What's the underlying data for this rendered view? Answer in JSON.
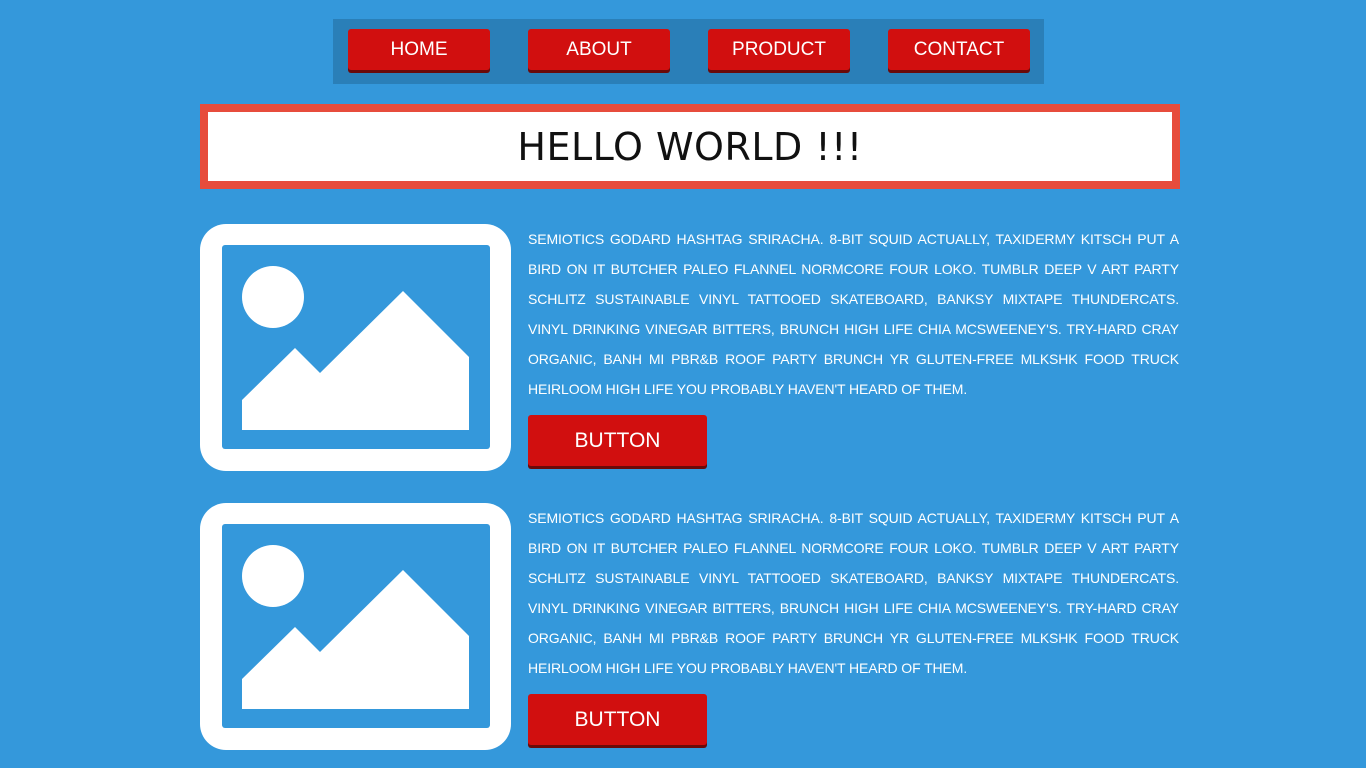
{
  "nav": {
    "items": [
      {
        "label": "HOME"
      },
      {
        "label": "ABOUT"
      },
      {
        "label": "PRODUCT"
      },
      {
        "label": "CONTACT"
      }
    ]
  },
  "hero": {
    "title": "HELLO WORLD !!!"
  },
  "cards": [
    {
      "text": "SEMIOTICS GODARD HASHTAG SRIRACHA. 8-BIT SQUID ACTUALLY, TAXIDERMY KITSCH PUT A BIRD ON IT BUTCHER PALEO FLANNEL NORMCORE FOUR LOKO. TUMBLR DEEP V ART PARTY SCHLITZ SUSTAINABLE VINYL TATTOOED SKATEBOARD, BANKSY MIXTAPE THUNDERCATS. VINYL DRINKING VINEGAR BITTERS, BRUNCH HIGH LIFE CHIA MCSWEENEY'S. TRY-HARD CRAY ORGANIC, BANH MI PBR&B ROOF PARTY BRUNCH YR GLUTEN-FREE MLKSHK FOOD TRUCK HEIRLOOM HIGH LIFE YOU PROBABLY HAVEN'T HEARD OF THEM.",
      "button_label": "BUTTON",
      "image_icon": "image-placeholder-icon"
    },
    {
      "text": "SEMIOTICS GODARD HASHTAG SRIRACHA. 8-BIT SQUID ACTUALLY, TAXIDERMY KITSCH PUT A BIRD ON IT BUTCHER PALEO FLANNEL NORMCORE FOUR LOKO. TUMBLR DEEP V ART PARTY SCHLITZ SUSTAINABLE VINYL TATTOOED SKATEBOARD, BANKSY MIXTAPE THUNDERCATS. VINYL DRINKING VINEGAR BITTERS, BRUNCH HIGH LIFE CHIA MCSWEENEY'S. TRY-HARD CRAY ORGANIC, BANH MI PBR&B ROOF PARTY BRUNCH YR GLUTEN-FREE MLKSHK FOOD TRUCK HEIRLOOM HIGH LIFE YOU PROBABLY HAVEN'T HEARD OF THEM.",
      "button_label": "BUTTON",
      "image_icon": "image-placeholder-icon"
    }
  ],
  "colors": {
    "background": "#3498db",
    "nav_bar": "#2a7fb8",
    "button": "#d10f0f",
    "hero_border": "#e74c3c",
    "hero_bg": "#ffffff"
  }
}
